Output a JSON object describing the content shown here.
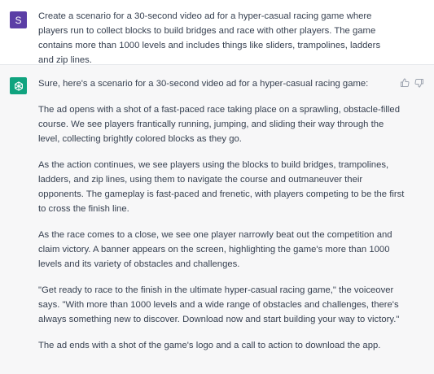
{
  "user_message": {
    "avatar_letter": "S",
    "avatar_color": "#5b3ea6",
    "text": "Create a scenario for a 30-second video ad for a hyper-casual racing game where players run to collect blocks to build bridges and race with other players. The game contains more than 1000 levels and includes things like sliders, trampolines, ladders and zip lines."
  },
  "assistant_message": {
    "avatar_icon": "openai-logo-icon",
    "avatar_color": "#10a37f",
    "paragraphs": [
      "Sure, here's a scenario for a 30-second video ad for a hyper-casual racing game:",
      "The ad opens with a shot of a fast-paced race taking place on a sprawling, obstacle-filled course. We see players frantically running, jumping, and sliding their way through the level, collecting brightly colored blocks as they go.",
      "As the action continues, we see players using the blocks to build bridges, trampolines, ladders, and zip lines, using them to navigate the course and outmaneuver their opponents. The gameplay is fast-paced and frenetic, with players competing to be the first to cross the finish line.",
      "As the race comes to a close, we see one player narrowly beat out the competition and claim victory. A banner appears on the screen, highlighting the game's more than 1000 levels and its variety of obstacles and challenges.",
      "\"Get ready to race to the finish in the ultimate hyper-casual racing game,\" the voiceover says. \"With more than 1000 levels and a wide range of obstacles and challenges, there's always something new to discover. Download now and start building your way to victory.\"",
      "The ad ends with a shot of the game's logo and a call to action to download the app."
    ],
    "feedback_icons": [
      "thumbs-up-icon",
      "thumbs-down-icon"
    ]
  }
}
